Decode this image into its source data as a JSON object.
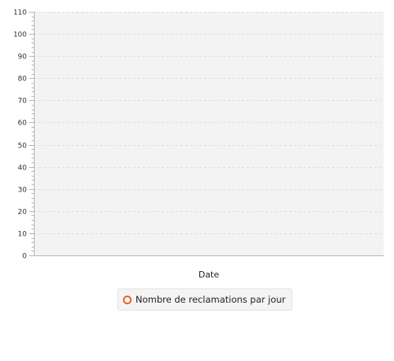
{
  "chart_data": {
    "type": "line",
    "title": "",
    "xlabel": "Date",
    "ylabel": "",
    "ylim": [
      0,
      110
    ],
    "y_ticks": [
      "0",
      "10",
      "20",
      "30",
      "40",
      "50",
      "60",
      "70",
      "80",
      "90",
      "100",
      "110"
    ],
    "minor_ticks_per_major": 5,
    "grid": true,
    "legend_position": "bottom-center",
    "series": [
      {
        "name": "Nombre de reclamations par jour",
        "color": "#f05a28",
        "x": [],
        "values": []
      }
    ]
  },
  "colors": {
    "plot_background": "#f3f3f3",
    "gridline": "#dcdcdc",
    "axis": "#b5b5b5",
    "series_marker": "#f05a28"
  }
}
